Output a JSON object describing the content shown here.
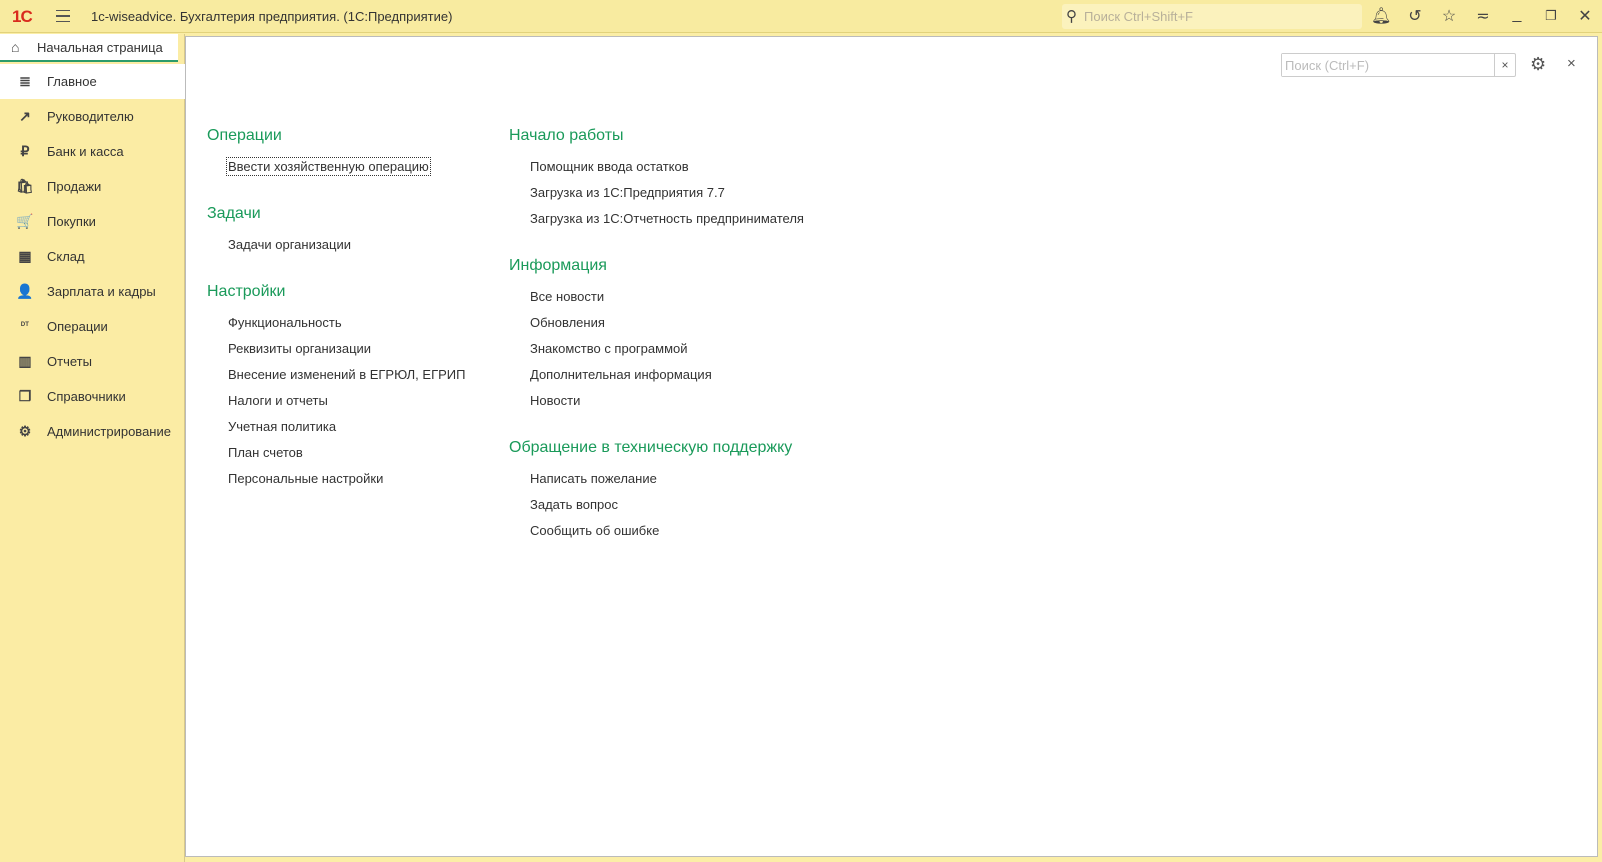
{
  "titlebar": {
    "title": "1c-wiseadvice. Бухгалтерия предприятия.  (1С:Предприятие)",
    "logo": "1С",
    "search_placeholder": "Поиск Ctrl+Shift+F"
  },
  "home_tab": "Начальная страница",
  "sidebar": [
    {
      "label": "Главное",
      "icon": "≣",
      "name": "menu-lines-icon"
    },
    {
      "label": "Руководителю",
      "icon": "↗",
      "name": "trend-icon"
    },
    {
      "label": "Банк и касса",
      "icon": "₽",
      "name": "ruble-icon"
    },
    {
      "label": "Продажи",
      "icon": "🛍",
      "name": "shopping-bag-icon"
    },
    {
      "label": "Покупки",
      "icon": "🛒",
      "name": "cart-icon"
    },
    {
      "label": "Склад",
      "icon": "▦",
      "name": "warehouse-icon"
    },
    {
      "label": "Зарплата и кадры",
      "icon": "👤",
      "name": "person-icon"
    },
    {
      "label": "Операции",
      "icon": "ᴰᵀ",
      "name": "dt-kt-icon"
    },
    {
      "label": "Отчеты",
      "icon": "▥",
      "name": "bar-chart-icon"
    },
    {
      "label": "Справочники",
      "icon": "❐",
      "name": "books-icon"
    },
    {
      "label": "Администрирование",
      "icon": "⚙",
      "name": "gear-icon"
    }
  ],
  "main": {
    "search_placeholder": "Поиск (Ctrl+F)",
    "clear": "×",
    "close": "×",
    "sections": [
      {
        "title": "Операции",
        "links": [
          "Ввести хозяйственную операцию"
        ]
      },
      {
        "title": "Задачи",
        "links": [
          "Задачи организации"
        ]
      },
      {
        "title": "Настройки",
        "links": [
          "Функциональность",
          "Реквизиты организации",
          "Внесение изменений в ЕГРЮЛ, ЕГРИП",
          "Налоги и отчеты",
          "Учетная политика",
          "План счетов",
          "Персональные настройки"
        ]
      },
      {
        "title": "Начало работы",
        "links": [
          "Помощник ввода остатков",
          "Загрузка из 1С:Предприятия 7.7",
          "Загрузка из 1С:Отчетность предпринимателя"
        ]
      },
      {
        "title": "Информация",
        "links": [
          "Все новости",
          "Обновления",
          "Знакомство с программой",
          "Дополнительная информация",
          "Новости"
        ]
      },
      {
        "title": "Обращение в техническую поддержку",
        "links": [
          "Написать пожелание",
          "Задать вопрос",
          "Сообщить об ошибке"
        ]
      }
    ]
  }
}
